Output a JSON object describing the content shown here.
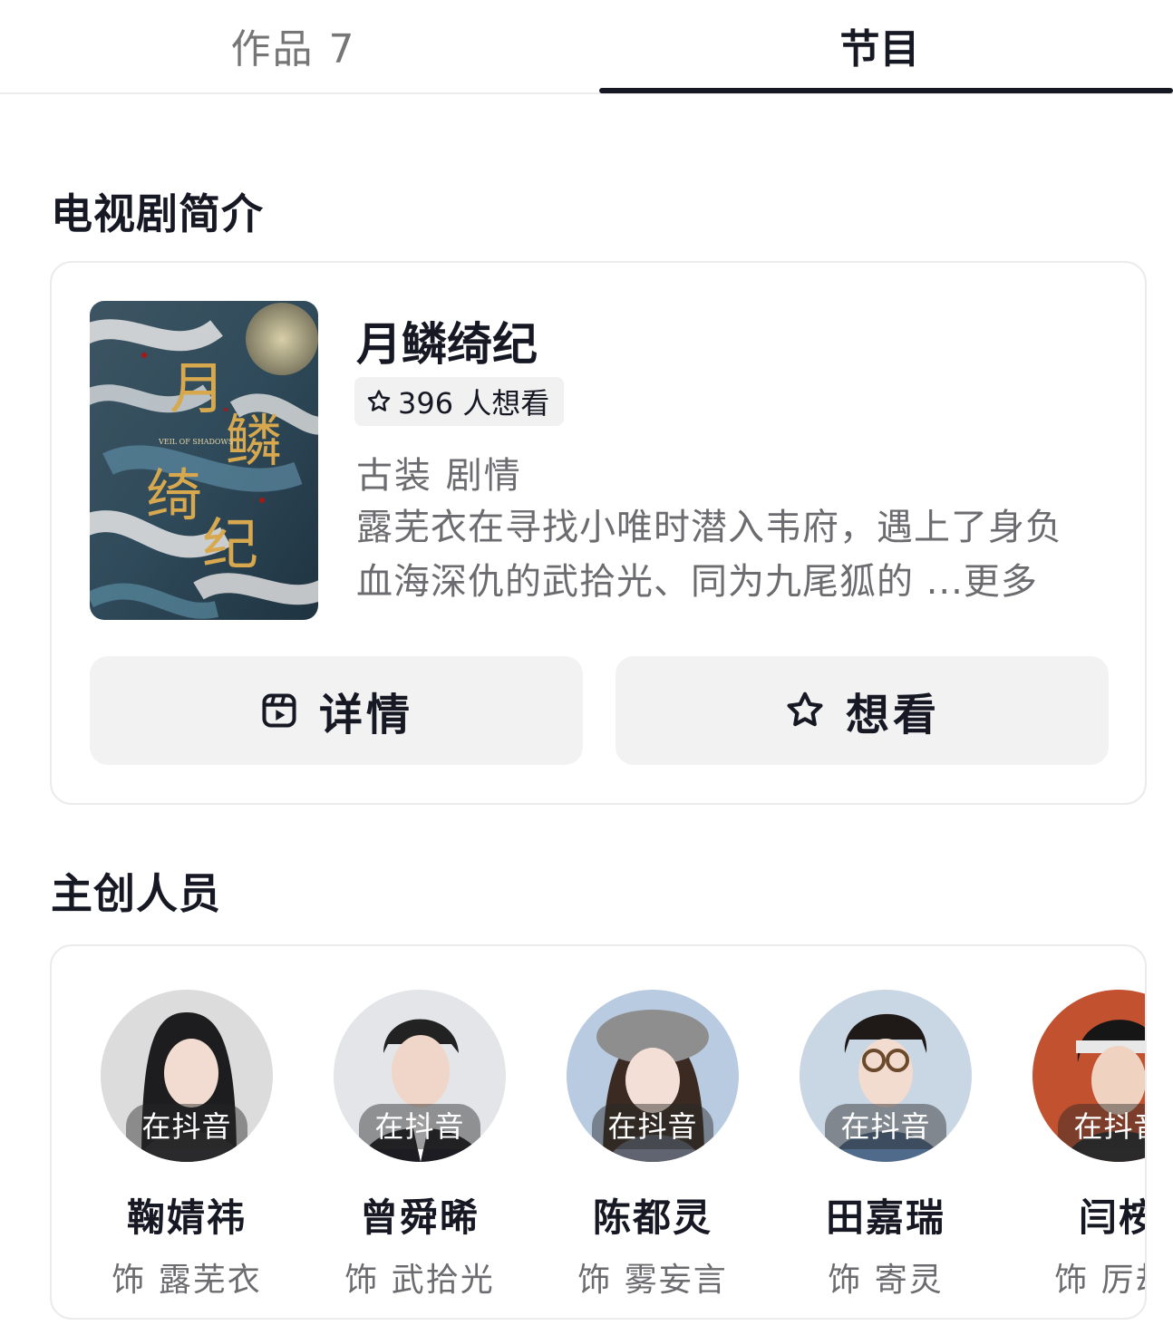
{
  "tabs": [
    {
      "label": "作品 7",
      "active": false
    },
    {
      "label": "节目",
      "active": true
    }
  ],
  "drama_section": {
    "title": "电视剧简介",
    "drama": {
      "title": "月鳞绮纪",
      "want_count_text": "396 人想看",
      "genres": "古装 剧情",
      "synopsis_line1": "露芜衣在寻找小唯时潜入韦府，遇上了身负",
      "synopsis_line2": "血海深仇的武拾光、同为九尾狐的 ",
      "more_label": "...更多",
      "poster_title_chars": [
        "月",
        "鳞",
        "绮",
        "纪"
      ],
      "poster_subtitle": "VEIL OF SHADOWS"
    },
    "buttons": {
      "detail_label": "详情",
      "detail_icon": "video-icon",
      "want_label": "想看",
      "want_icon": "star-icon"
    }
  },
  "crew_section": {
    "title": "主创人员",
    "members": [
      {
        "name": "鞠婧祎",
        "role": "饰 露芜衣",
        "tag": "在抖音",
        "bg": "#dcdcdc"
      },
      {
        "name": "曾舜晞",
        "role": "饰 武拾光",
        "tag": "在抖音",
        "bg": "#e3e5e8"
      },
      {
        "name": "陈都灵",
        "role": "饰 雾妄言",
        "tag": "在抖音",
        "bg": "#b9cbe0"
      },
      {
        "name": "田嘉瑞",
        "role": "饰 寄灵",
        "tag": "在抖音",
        "bg": "#c9d6e3"
      },
      {
        "name": "闫桉",
        "role": "饰 厉劫/",
        "tag": "在抖音",
        "bg": "#c2512f"
      }
    ]
  },
  "colors": {
    "text_primary": "#161823",
    "text_secondary": "#6b6b70",
    "button_bg": "#f2f2f3",
    "tab_indicator": "#161823"
  }
}
